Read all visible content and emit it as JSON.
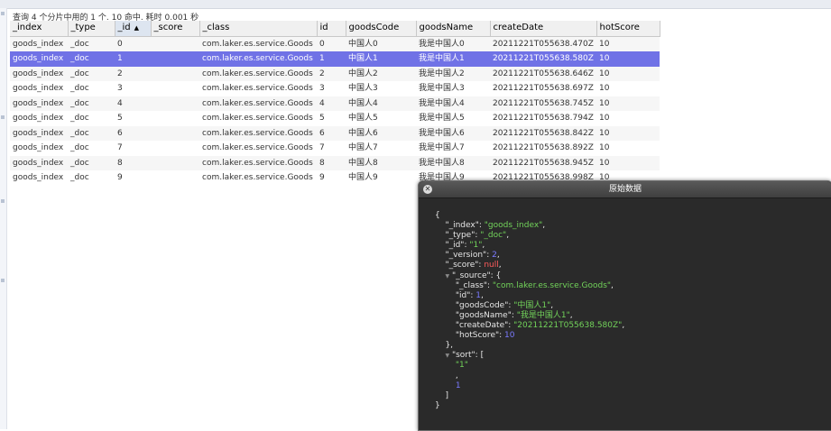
{
  "status": "查询 4 个分片中用的 1 个. 10 命中. 耗时 0.001 秒",
  "colors": {
    "selected_row": "#7072e6",
    "dialog_bg": "#2a2a2a",
    "json_string": "#72d35a",
    "json_number": "#7a7aff",
    "json_null": "#ff5b5b"
  },
  "table": {
    "sorted_column": "_id",
    "sort_direction_icon": "sort-ascending-icon",
    "sort_arrow_glyph": "▲",
    "columns": [
      "_index",
      "_type",
      "_id",
      "_score",
      "_class",
      "id",
      "goodsCode",
      "goodsName",
      "createDate",
      "hotScore"
    ],
    "selected_index": 1,
    "rows": [
      [
        "goods_index",
        "_doc",
        "0",
        "",
        "com.laker.es.service.Goods",
        "0",
        "中国人0",
        "我是中国人0",
        "20211221T055638.470Z",
        "10"
      ],
      [
        "goods_index",
        "_doc",
        "1",
        "",
        "com.laker.es.service.Goods",
        "1",
        "中国人1",
        "我是中国人1",
        "20211221T055638.580Z",
        "10"
      ],
      [
        "goods_index",
        "_doc",
        "2",
        "",
        "com.laker.es.service.Goods",
        "2",
        "中国人2",
        "我是中国人2",
        "20211221T055638.646Z",
        "10"
      ],
      [
        "goods_index",
        "_doc",
        "3",
        "",
        "com.laker.es.service.Goods",
        "3",
        "中国人3",
        "我是中国人3",
        "20211221T055638.697Z",
        "10"
      ],
      [
        "goods_index",
        "_doc",
        "4",
        "",
        "com.laker.es.service.Goods",
        "4",
        "中国人4",
        "我是中国人4",
        "20211221T055638.745Z",
        "10"
      ],
      [
        "goods_index",
        "_doc",
        "5",
        "",
        "com.laker.es.service.Goods",
        "5",
        "中国人5",
        "我是中国人5",
        "20211221T055638.794Z",
        "10"
      ],
      [
        "goods_index",
        "_doc",
        "6",
        "",
        "com.laker.es.service.Goods",
        "6",
        "中国人6",
        "我是中国人6",
        "20211221T055638.842Z",
        "10"
      ],
      [
        "goods_index",
        "_doc",
        "7",
        "",
        "com.laker.es.service.Goods",
        "7",
        "中国人7",
        "我是中国人7",
        "20211221T055638.892Z",
        "10"
      ],
      [
        "goods_index",
        "_doc",
        "8",
        "",
        "com.laker.es.service.Goods",
        "8",
        "中国人8",
        "我是中国人8",
        "20211221T055638.945Z",
        "10"
      ],
      [
        "goods_index",
        "_doc",
        "9",
        "",
        "com.laker.es.service.Goods",
        "9",
        "中国人9",
        "我是中国人9",
        "20211221T055638.998Z",
        "10"
      ]
    ]
  },
  "dialog": {
    "title": "原始数据",
    "close_icon": "close-icon",
    "close_glyph": "✕",
    "collapse_icon": "collapse-triangle-icon",
    "collapse_glyph": "▼",
    "json": {
      "_index": "goods_index",
      "_type": "_doc",
      "_id": "1",
      "_version": 2,
      "_score": null,
      "_source": {
        "_class": "com.laker.es.service.Goods",
        "id": 1,
        "goodsCode": "中国人1",
        "goodsName": "我是中国人1",
        "createDate": "20211221T055638.580Z",
        "hotScore": 10
      },
      "sort": [
        "1",
        1
      ]
    }
  }
}
